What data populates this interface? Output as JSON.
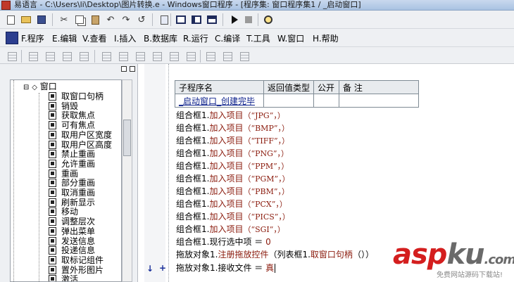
{
  "window": {
    "title": "易语言 - C:\\Users\\li\\Desktop\\图片转换.e - Windows窗口程序 - [程序集: 窗口程序集1 / _启动窗口]"
  },
  "colors": {
    "keyword_red": "#8a1a0c",
    "link_blue": "#0a1e8a",
    "watermark_red": "#d41e1e",
    "watermark_gray": "#6a6a6a"
  },
  "toolbar": {
    "icons": [
      "new-file-icon",
      "open-file-icon",
      "save-icon",
      "cut-icon",
      "copy-icon",
      "paste-icon",
      "undo-icon",
      "redo-icon",
      "undo-history-icon",
      "preview-icon",
      "layout-icon",
      "layout-columns-icon",
      "layout-split-icon",
      "run-icon",
      "stop-icon",
      "find-tool-icon"
    ]
  },
  "menu": {
    "items": [
      "F.程序",
      "E.编辑",
      "V.查看",
      "I.插入",
      "B.数据库",
      "R.运行",
      "C.编译",
      "T.工具",
      "W.窗口",
      "H.帮助"
    ]
  },
  "tree": {
    "root": "窗口",
    "items": [
      "取窗口句柄",
      "销毁",
      "获取焦点",
      "可有焦点",
      "取用户区宽度",
      "取用户区高度",
      "禁止重画",
      "允许重画",
      "重画",
      "部分重画",
      "取消重画",
      "刷新显示",
      "移动",
      "调整层次",
      "弹出菜单",
      "发送信息",
      "投递信息",
      "取标记组件",
      "置外形图片",
      "激活"
    ]
  },
  "editor": {
    "table": {
      "headers": [
        "子程序名",
        "返回值类型",
        "公开",
        "备 注"
      ],
      "row": [
        "_启动窗口_创建完毕",
        "",
        "",
        ""
      ]
    },
    "lines": [
      {
        "obj": "组合框1.",
        "fn": "加入项目",
        "arg": "（“JPG”，）"
      },
      {
        "obj": "组合框1.",
        "fn": "加入项目",
        "arg": "（“BMP”，）"
      },
      {
        "obj": "组合框1.",
        "fn": "加入项目",
        "arg": "（“TIFF”，）"
      },
      {
        "obj": "组合框1.",
        "fn": "加入项目",
        "arg": "（“PNG”，）"
      },
      {
        "obj": "组合框1.",
        "fn": "加入项目",
        "arg": "（“PPM”，）"
      },
      {
        "obj": "组合框1.",
        "fn": "加入项目",
        "arg": "（“PGM”，）"
      },
      {
        "obj": "组合框1.",
        "fn": "加入项目",
        "arg": "（“PBM”，）"
      },
      {
        "obj": "组合框1.",
        "fn": "加入项目",
        "arg": "（“PCX”，）"
      },
      {
        "obj": "组合框1.",
        "fn": "加入项目",
        "arg": "（“PICS”，）"
      },
      {
        "obj": "组合框1.",
        "fn": "加入项目",
        "arg": "（“SGI”，）"
      }
    ],
    "line_select": {
      "lhs": "组合框1.现行选中项 ＝ ",
      "val": "0"
    },
    "line_drag": {
      "obj": "拖放对象1.",
      "fn": "注册拖放控件",
      "mid": "（列表框1.",
      "fn2": "取窗口句柄",
      "end": "（））"
    },
    "line_receive": {
      "lhs": "拖放对象1.接收文件 ＝ ",
      "val": "真"
    },
    "markers": {
      "arrow": "↓",
      "plus": "+"
    }
  },
  "watermark": {
    "logo_a": "asp",
    "logo_b": "ku",
    "logo_c": ".com",
    "tagline": "免费网站源码下载站!"
  }
}
